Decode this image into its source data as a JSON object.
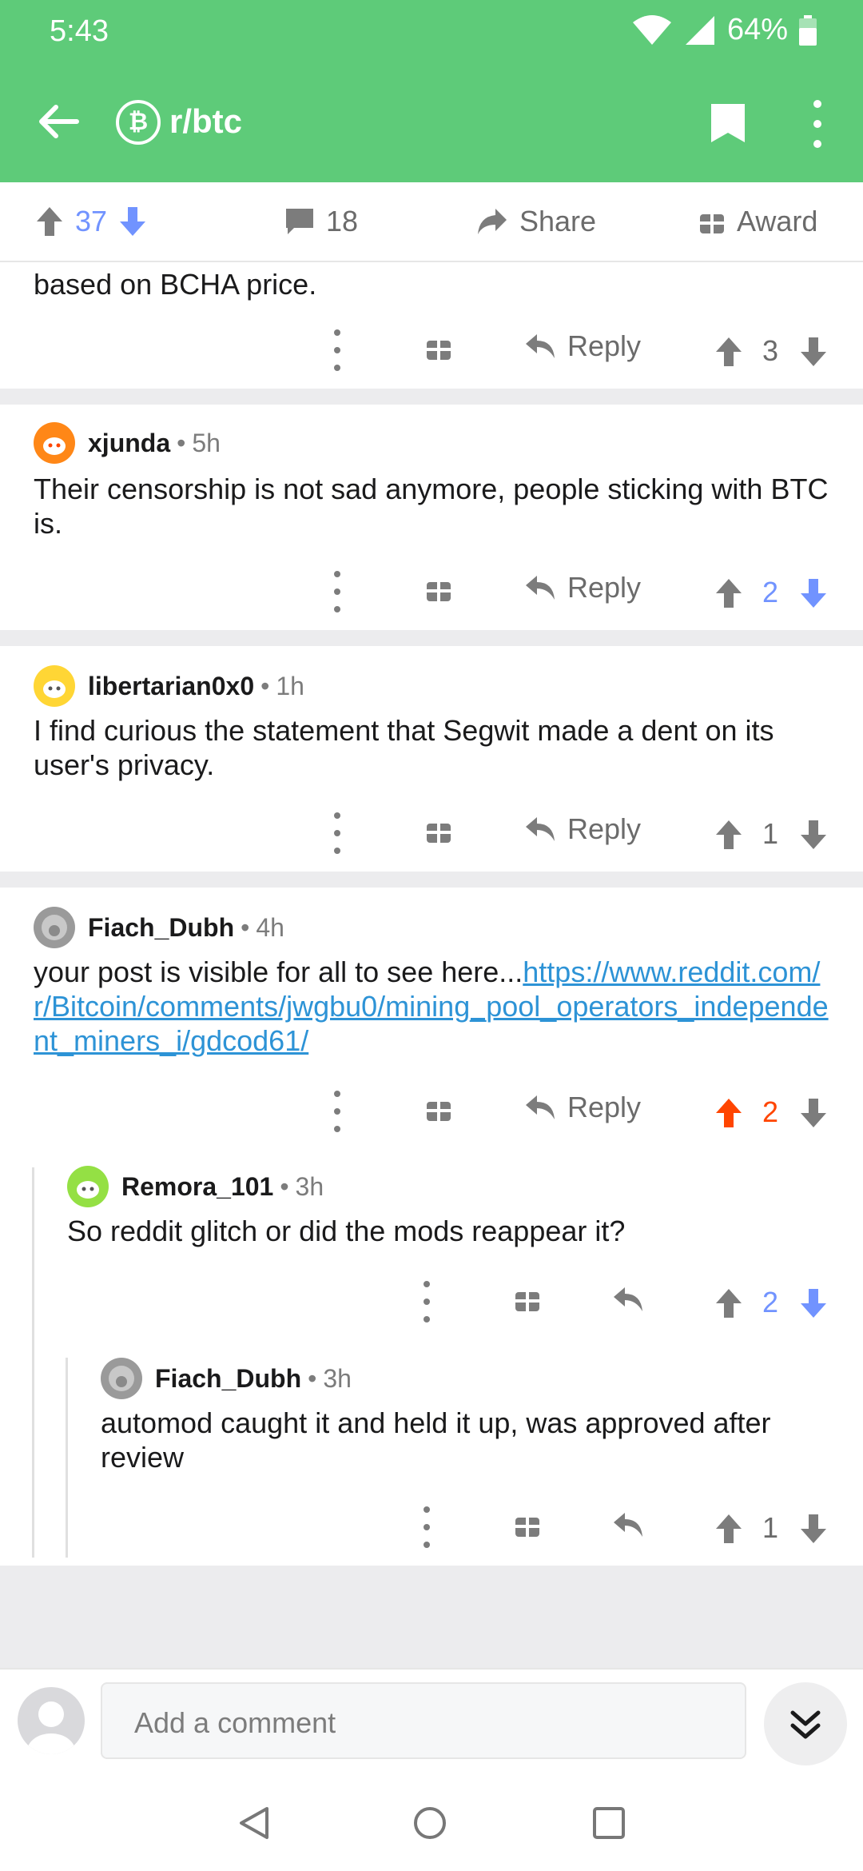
{
  "status_bar": {
    "time": "5:43",
    "battery": "64%"
  },
  "header": {
    "subreddit": "r/btc"
  },
  "post_bar": {
    "votes": "37",
    "comments": "18",
    "share_label": "Share",
    "award_label": "Award"
  },
  "colors": {
    "accent": "#5ecb79",
    "upvote_active": "#ff4500",
    "downvote_active": "#7193ff",
    "link": "#2d93d6"
  },
  "comments": [
    {
      "body": "based on BCHA price.",
      "reply_label": "Reply",
      "score": "3"
    },
    {
      "user": "xjunda",
      "age": "5h",
      "body": "Their censorship is not sad anymore, people sticking with BTC is.",
      "reply_label": "Reply",
      "score": "2"
    },
    {
      "user": "libertarian0x0",
      "age": "1h",
      "body": "I find curious the statement that Segwit made a dent on its user's privacy.",
      "reply_label": "Reply",
      "score": "1"
    },
    {
      "user": "Fiach_Dubh",
      "age": "4h",
      "body_prefix": "your post is visible for all to see here...",
      "link": "https://www.reddit.com/r/Bitcoin/comments/jwgbu0/mining_pool_operators_independent_miners_i/gdcod61/",
      "reply_label": "Reply",
      "score": "2"
    },
    {
      "user": "Remora_101",
      "age": "3h",
      "body": "So reddit glitch or did the mods reappear it?",
      "score": "2"
    },
    {
      "user": "Fiach_Dubh",
      "age": "3h",
      "body": "automod caught it and held it up, was approved after review",
      "score": "1"
    }
  ],
  "composer": {
    "placeholder": "Add a comment"
  },
  "separator": "•"
}
